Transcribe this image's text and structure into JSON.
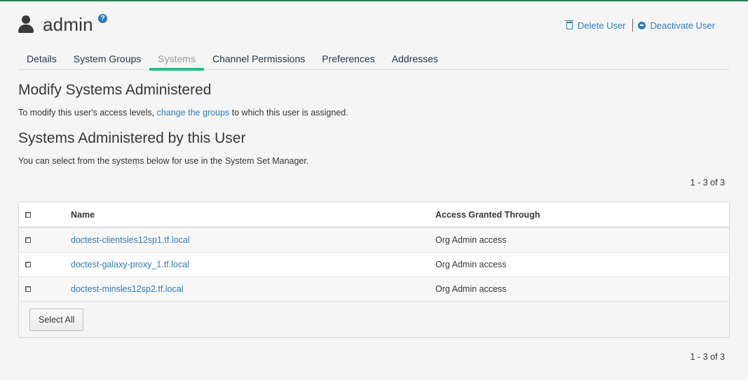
{
  "header": {
    "title": "admin",
    "help_glyph": "?",
    "user_icon": "user-icon",
    "actions": {
      "delete_label": "Delete User",
      "deactivate_label": "Deactivate User"
    }
  },
  "tabs": [
    {
      "label": "Details",
      "active": false
    },
    {
      "label": "System Groups",
      "active": false
    },
    {
      "label": "Systems",
      "active": true
    },
    {
      "label": "Channel Permissions",
      "active": false
    },
    {
      "label": "Preferences",
      "active": false
    },
    {
      "label": "Addresses",
      "active": false
    }
  ],
  "modify": {
    "heading": "Modify Systems Administered",
    "text_before": "To modify this user's access levels, ",
    "link": "change the groups",
    "text_after": " to which this user is assigned."
  },
  "administered": {
    "heading": "Systems Administered by this User",
    "text": "You can select from the systems below for use in the System Set Manager."
  },
  "pagination": {
    "top": "1 - 3 of 3",
    "bottom": "1 - 3 of 3"
  },
  "table": {
    "columns": [
      "Name",
      "Access Granted Through"
    ],
    "rows": [
      {
        "name": "doctest-clientsles12sp1.tf.local",
        "access": "Org Admin access"
      },
      {
        "name": "doctest-galaxy-proxy_1.tf.local",
        "access": "Org Admin access"
      },
      {
        "name": "doctest-minsles12sp2.tf.local",
        "access": "Org Admin access"
      }
    ],
    "select_all_label": "Select All"
  },
  "colors": {
    "accent": "#20bf8a",
    "link": "#2e7cba",
    "top_border": "#2e7d52"
  }
}
